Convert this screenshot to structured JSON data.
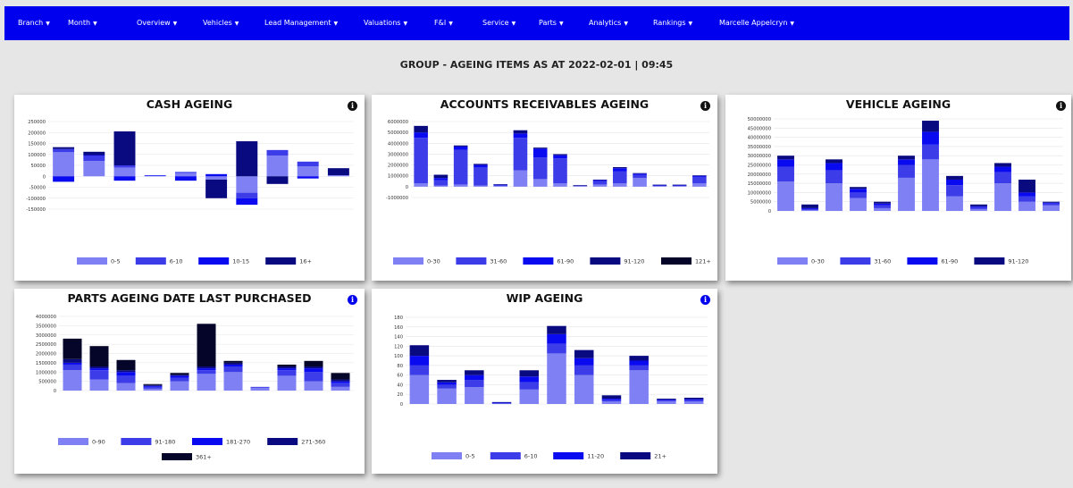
{
  "nav": {
    "items": [
      {
        "label": "Branch"
      },
      {
        "label": "Month"
      },
      {
        "label": "Overview"
      },
      {
        "label": "Vehicles"
      },
      {
        "label": "Lead Management"
      },
      {
        "label": "Valuations"
      },
      {
        "label": "F&I"
      },
      {
        "label": "Service"
      },
      {
        "label": "Parts"
      },
      {
        "label": "Analytics"
      },
      {
        "label": "Rankings"
      },
      {
        "label": "Marcelle Appelcryn"
      }
    ]
  },
  "page": {
    "title": "GROUP - AGEING ITEMS AS AT 2022-02-01 | 09:45"
  },
  "colors": {
    "nav_bg": "#0000ee",
    "page_bg": "#e6e6e6",
    "series": [
      "#8080f5",
      "#3c3ce8",
      "#0a0af0",
      "#0a0a80",
      "#05052a"
    ]
  },
  "chart_data": [
    {
      "id": "cash",
      "type": "bar",
      "stacked": true,
      "title": "CASH AGEING",
      "info_icon": "black",
      "ylim": [
        -150000,
        250000
      ],
      "yticks": [
        -150000,
        -100000,
        -50000,
        0,
        50000,
        100000,
        150000,
        200000,
        250000
      ],
      "legend_rows": [
        [
          0,
          1,
          2,
          3
        ]
      ],
      "series": [
        {
          "name": "0-5",
          "values": [
            110000,
            70000,
            40000,
            2000,
            15000,
            -15000,
            -75000,
            95000,
            45000,
            5000
          ]
        },
        {
          "name": "6-10",
          "values": [
            15000,
            25000,
            10000,
            0,
            5000,
            0,
            -25000,
            25000,
            22000,
            0
          ]
        },
        {
          "name": "10-15",
          "values": [
            -25000,
            2000,
            -20000,
            3000,
            -20000,
            10000,
            -30000,
            0,
            -10000,
            0
          ]
        },
        {
          "name": "16+",
          "values": [
            8000,
            15000,
            155000,
            0,
            0,
            -85000,
            160000,
            -35000,
            0,
            32000
          ]
        }
      ],
      "neg_series": [
        {
          "values": [
            -25000,
            0,
            -20000,
            0,
            -20000,
            -100000,
            -130000,
            -35000,
            -10000,
            -15000
          ]
        }
      ]
    },
    {
      "id": "ar",
      "type": "bar",
      "stacked": true,
      "title": "ACCOUNTS RECEIVABLES AGEING",
      "info_icon": "black",
      "ylim": [
        -1000000,
        6000000
      ],
      "yticks": [
        -1000000,
        0,
        1000000,
        2000000,
        3000000,
        4000000,
        5000000,
        6000000
      ],
      "legend_rows": [
        [
          0,
          1,
          2,
          3,
          4
        ]
      ],
      "series": [
        {
          "name": "0-30",
          "values": [
            300000,
            100000,
            200000,
            100000,
            50000,
            1500000,
            700000,
            300000,
            50000,
            200000,
            300000,
            800000,
            50000,
            50000,
            300000
          ]
        },
        {
          "name": "31-60",
          "values": [
            4200000,
            500000,
            3200000,
            1700000,
            100000,
            3000000,
            2000000,
            2300000,
            50000,
            300000,
            1100000,
            300000,
            100000,
            100000,
            600000
          ]
        },
        {
          "name": "61-90",
          "values": [
            500000,
            200000,
            300000,
            200000,
            50000,
            400000,
            800000,
            300000,
            20000,
            100000,
            300000,
            100000,
            20000,
            20000,
            100000
          ]
        },
        {
          "name": "91-120",
          "values": [
            600000,
            300000,
            100000,
            100000,
            20000,
            300000,
            100000,
            100000,
            10000,
            50000,
            100000,
            50000,
            10000,
            10000,
            50000
          ]
        },
        {
          "name": "121+",
          "values": [
            0,
            0,
            0,
            0,
            0,
            0,
            0,
            0,
            0,
            0,
            0,
            0,
            0,
            0,
            0
          ]
        }
      ]
    },
    {
      "id": "vehicle",
      "type": "bar",
      "stacked": true,
      "title": "VEHICLE AGEING",
      "info_icon": "black",
      "ylim": [
        0,
        50000000
      ],
      "yticks": [
        0,
        5000000,
        10000000,
        15000000,
        20000000,
        25000000,
        30000000,
        35000000,
        40000000,
        45000000,
        50000000
      ],
      "legend_rows": [
        [
          0,
          1,
          2,
          3
        ]
      ],
      "series": [
        {
          "name": "0-30",
          "values": [
            16000000,
            500000,
            15000000,
            7000000,
            1500000,
            18000000,
            28000000,
            8000000,
            1000000,
            15000000,
            5000000,
            3000000
          ]
        },
        {
          "name": "31-60",
          "values": [
            8000000,
            500000,
            7000000,
            3000000,
            1500000,
            7000000,
            8000000,
            6000000,
            1000000,
            6000000,
            3000000,
            1000000
          ]
        },
        {
          "name": "61-90",
          "values": [
            4000000,
            500000,
            4000000,
            2000000,
            1000000,
            3000000,
            7000000,
            3000000,
            500000,
            3000000,
            2000000,
            500000
          ]
        },
        {
          "name": "91-120",
          "values": [
            2000000,
            2000000,
            2000000,
            1000000,
            1000000,
            2000000,
            6000000,
            2000000,
            1000000,
            2000000,
            7000000,
            500000
          ]
        }
      ]
    },
    {
      "id": "parts",
      "type": "bar",
      "stacked": true,
      "title": "PARTS AGEING DATE LAST PURCHASED",
      "info_icon": "blue",
      "ylim": [
        0,
        4000000
      ],
      "yticks": [
        0,
        500000,
        1000000,
        1500000,
        2000000,
        2500000,
        3000000,
        3500000,
        4000000
      ],
      "legend_rows": [
        [
          0,
          1,
          2,
          3
        ],
        [
          4
        ]
      ],
      "series": [
        {
          "name": "0-90",
          "values": [
            1100000,
            600000,
            400000,
            100000,
            500000,
            900000,
            1000000,
            150000,
            800000,
            500000,
            200000
          ]
        },
        {
          "name": "91-180",
          "values": [
            300000,
            500000,
            400000,
            100000,
            200000,
            200000,
            300000,
            50000,
            300000,
            500000,
            200000
          ]
        },
        {
          "name": "181-270",
          "values": [
            100000,
            100000,
            200000,
            50000,
            100000,
            100000,
            100000,
            0,
            100000,
            200000,
            100000
          ]
        },
        {
          "name": "271-360",
          "values": [
            200000,
            100000,
            100000,
            50000,
            50000,
            100000,
            100000,
            0,
            100000,
            100000,
            100000
          ]
        },
        {
          "name": "361+",
          "values": [
            1100000,
            1100000,
            550000,
            50000,
            100000,
            2300000,
            100000,
            0,
            100000,
            300000,
            350000
          ]
        }
      ]
    },
    {
      "id": "wip",
      "type": "bar",
      "stacked": true,
      "title": "WIP AGEING",
      "info_icon": "blue",
      "ylim": [
        0,
        180
      ],
      "yticks": [
        0,
        20,
        40,
        60,
        80,
        100,
        120,
        140,
        160,
        180
      ],
      "legend_rows": [
        [
          0,
          1,
          2,
          3
        ]
      ],
      "series": [
        {
          "name": "0-5",
          "values": [
            60,
            32,
            35,
            1,
            30,
            105,
            60,
            5,
            70,
            5,
            5
          ]
        },
        {
          "name": "6-10",
          "values": [
            20,
            8,
            15,
            1,
            15,
            20,
            20,
            3,
            10,
            2,
            3
          ]
        },
        {
          "name": "11-20",
          "values": [
            20,
            5,
            10,
            1,
            12,
            20,
            15,
            3,
            10,
            2,
            2
          ]
        },
        {
          "name": "21+",
          "values": [
            22,
            5,
            10,
            1,
            13,
            17,
            17,
            7,
            10,
            2,
            3
          ]
        }
      ]
    }
  ]
}
